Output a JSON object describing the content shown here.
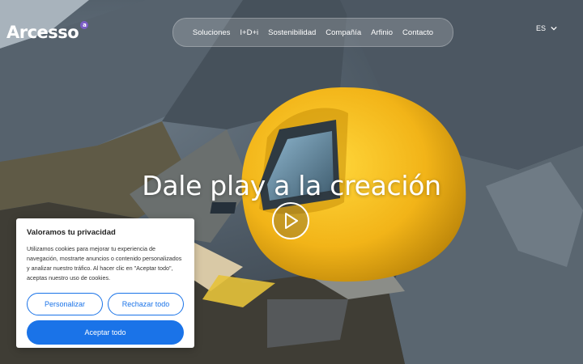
{
  "brand": {
    "name": "Arcesso",
    "badge": "a"
  },
  "nav": {
    "items": [
      "Soluciones",
      "I+D+i",
      "Sostenibilidad",
      "Compañía",
      "Arfinio",
      "Contacto"
    ]
  },
  "language": {
    "current": "ES"
  },
  "hero": {
    "headline": "Dale play a la creación"
  },
  "cookie_banner": {
    "title": "Valoramos tu privacidad",
    "body": "Utilizamos cookies para mejorar tu experiencia de navegación, mostrarte anuncios o contenido personalizados y analizar nuestro tráfico. Al hacer clic en \"Aceptar todo\", aceptas nuestro uso de cookies.",
    "customize_label": "Personalizar",
    "reject_label": "Rechazar todo",
    "accept_label": "Aceptar todo"
  },
  "colors": {
    "accent": "#1a73e8",
    "kiosk_yellow": "#f2b418",
    "logo_badge": "#7b5cc6"
  }
}
